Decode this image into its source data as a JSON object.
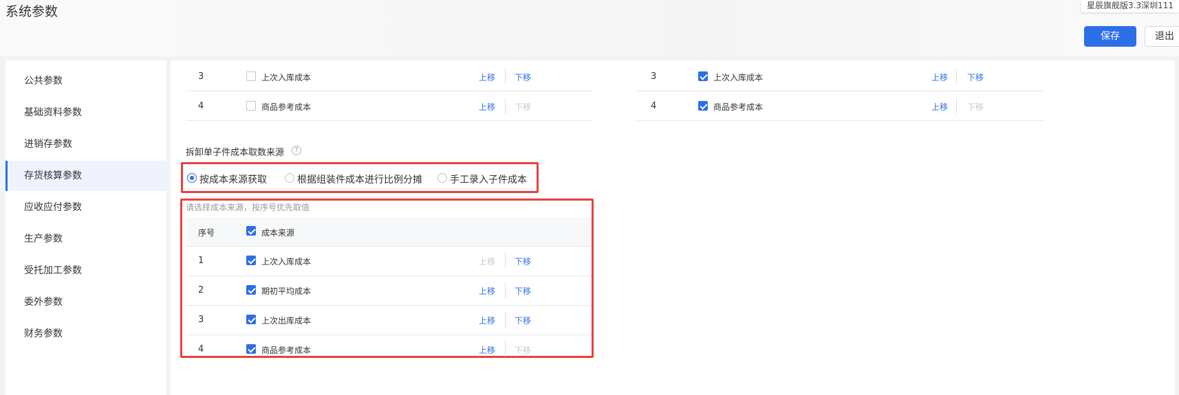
{
  "page": {
    "title": "系统参数",
    "account": "星辰旗舰版3.3深圳111",
    "save_label": "保存",
    "exit_label": "退出"
  },
  "sidebar": {
    "items": [
      {
        "label": "公共参数",
        "active": false
      },
      {
        "label": "基础资料参数",
        "active": false
      },
      {
        "label": "进销存参数",
        "active": false
      },
      {
        "label": "存货核算参数",
        "active": true
      },
      {
        "label": "应收应付参数",
        "active": false
      },
      {
        "label": "生产参数",
        "active": false
      },
      {
        "label": "受托加工参数",
        "active": false
      },
      {
        "label": "委外参数",
        "active": false
      },
      {
        "label": "财务参数",
        "active": false
      }
    ]
  },
  "top_left_rows": [
    {
      "num": "3",
      "label": "上次入库成本",
      "checked": false,
      "up": "上移",
      "down": "下移",
      "up_enabled": true,
      "down_enabled": true
    },
    {
      "num": "4",
      "label": "商品参考成本",
      "checked": false,
      "up": "上移",
      "down": "下移",
      "up_enabled": true,
      "down_enabled": false
    }
  ],
  "top_right_rows": [
    {
      "num": "3",
      "label": "上次入库成本",
      "checked": true,
      "up": "上移",
      "down": "下移",
      "up_enabled": true,
      "down_enabled": true
    },
    {
      "num": "4",
      "label": "商品参考成本",
      "checked": true,
      "up": "上移",
      "down": "下移",
      "up_enabled": true,
      "down_enabled": false
    }
  ],
  "disassembly": {
    "title": "拆卸单子件成本取数来源",
    "help_icon": "question-circle-icon",
    "options": [
      {
        "label": "按成本来源获取",
        "checked": true
      },
      {
        "label": "根据组装件成本进行比例分摊",
        "checked": false
      },
      {
        "label": "手工录入子件成本",
        "checked": false
      }
    ],
    "hint": "请选择成本来源，按序号优先取值",
    "header": {
      "seq": "序号",
      "source": "成本来源",
      "checked": true
    },
    "rows": [
      {
        "num": "1",
        "label": "上次入库成本",
        "checked": true,
        "up": "上移",
        "down": "下移",
        "up_enabled": false,
        "down_enabled": true
      },
      {
        "num": "2",
        "label": "期初平均成本",
        "checked": true,
        "up": "上移",
        "down": "下移",
        "up_enabled": true,
        "down_enabled": true
      },
      {
        "num": "3",
        "label": "上次出库成本",
        "checked": true,
        "up": "上移",
        "down": "下移",
        "up_enabled": true,
        "down_enabled": true
      },
      {
        "num": "4",
        "label": "商品参考成本",
        "checked": true,
        "up": "上移",
        "down": "下移",
        "up_enabled": true,
        "down_enabled": false
      }
    ]
  },
  "colors": {
    "accent": "#2b6ee8",
    "highlight_border": "#e8413f",
    "disabled_link": "#c5c8ce"
  }
}
